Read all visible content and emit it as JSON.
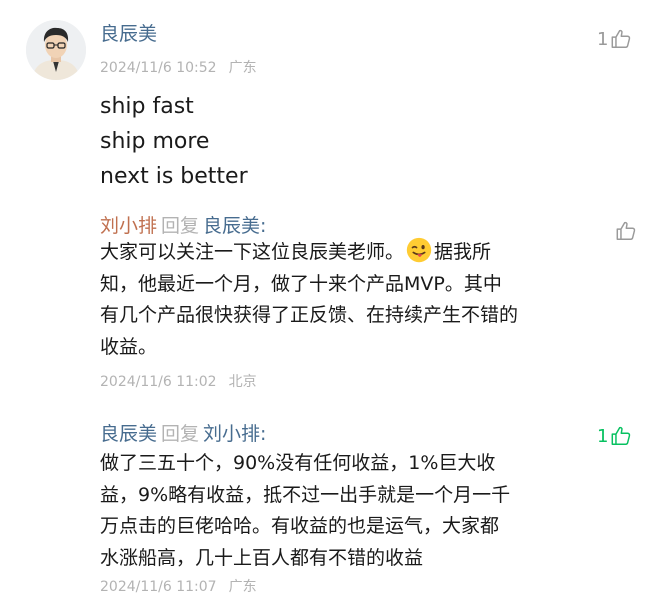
{
  "comment": {
    "author": "良辰美",
    "datetime": "2024/11/6 10:52",
    "location": "广东",
    "lines": [
      "ship fast",
      "ship more",
      "next is better"
    ],
    "likes": "1"
  },
  "replies": [
    {
      "author": "刘小排",
      "reply_word": "回复",
      "reply_to": "良辰美:",
      "line1_before_emoji": "大家可以关注一下这位良辰美老师。",
      "line1_after_emoji": "据我所",
      "line2": "知，他最近一个月，做了十来个产品MVP。其中",
      "line3": "有几个产品很快获得了正反馈、在持续产生不错的",
      "line4": "收益。",
      "emoji": "wink-tongue-emoji",
      "datetime": "2024/11/6 11:02",
      "location": "北京",
      "likes": ""
    },
    {
      "author": "良辰美",
      "reply_word": "回复",
      "reply_to": "刘小排:",
      "line1": "做了三五十个，90%没有任何收益，1%巨大收",
      "line2": "益，9%略有收益，抵不过一出手就是一个月一千",
      "line3": "万点击的巨佬哈哈。有收益的也是运气，大家都",
      "line4": "水涨船高，几十上百人都有不错的收益",
      "datetime": "2024/11/6 11:07",
      "location": "广东",
      "likes": "1",
      "liked": true
    }
  ],
  "colors": {
    "author_blue": "#476c8f",
    "author_orange": "#c0704f",
    "meta_gray": "#b3b3b3",
    "liked_green": "#07c160"
  },
  "icons": {
    "like": "thumbs-up-outline-icon",
    "avatar": "user-avatar"
  }
}
